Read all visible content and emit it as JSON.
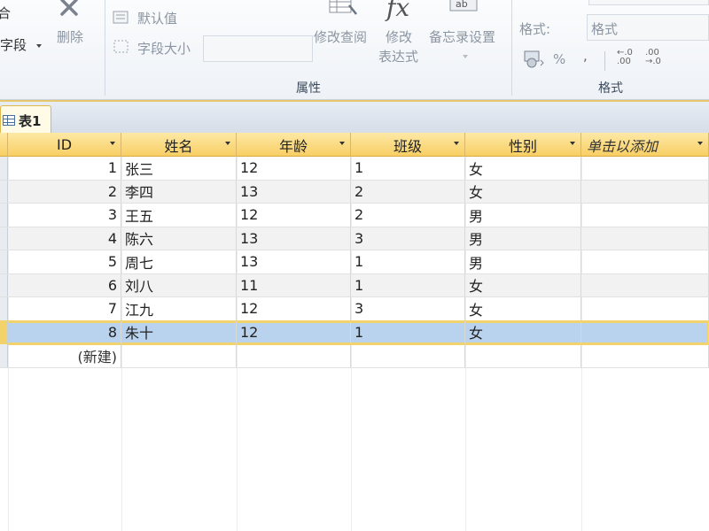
{
  "ribbon": {
    "left_partial": "合",
    "add_field_label": "字段",
    "delete_label": "删除",
    "default_value_label": "默认值",
    "field_size_label": "字段大小",
    "modify_lookup_label": "修改查阅",
    "modify_expression_line1": "修改",
    "modify_expression_line2": "表达式",
    "memo_settings_label": "备忘录设置",
    "properties_group_label": "属性",
    "format_label": "格式:",
    "format_value": "格式",
    "percent_symbol": "%",
    "comma_symbol": ",",
    "format_group_label": "格式"
  },
  "tab": {
    "label": "表1"
  },
  "table": {
    "headers": [
      "ID",
      "姓名",
      "年龄",
      "班级",
      "性别",
      "单击以添加"
    ],
    "rows": [
      {
        "id": "1",
        "name": "张三",
        "age": "12",
        "class": "1",
        "gender": "女"
      },
      {
        "id": "2",
        "name": "李四",
        "age": "13",
        "class": "2",
        "gender": "女"
      },
      {
        "id": "3",
        "name": "王五",
        "age": "12",
        "class": "2",
        "gender": "男"
      },
      {
        "id": "4",
        "name": "陈六",
        "age": "13",
        "class": "3",
        "gender": "男"
      },
      {
        "id": "5",
        "name": "周七",
        "age": "13",
        "class": "1",
        "gender": "男"
      },
      {
        "id": "6",
        "name": "刘八",
        "age": "11",
        "class": "1",
        "gender": "女"
      },
      {
        "id": "7",
        "name": "江九",
        "age": "12",
        "class": "3",
        "gender": "女"
      },
      {
        "id": "8",
        "name": "朱十",
        "age": "12",
        "class": "1",
        "gender": "女"
      }
    ],
    "new_row_label": "(新建)"
  }
}
